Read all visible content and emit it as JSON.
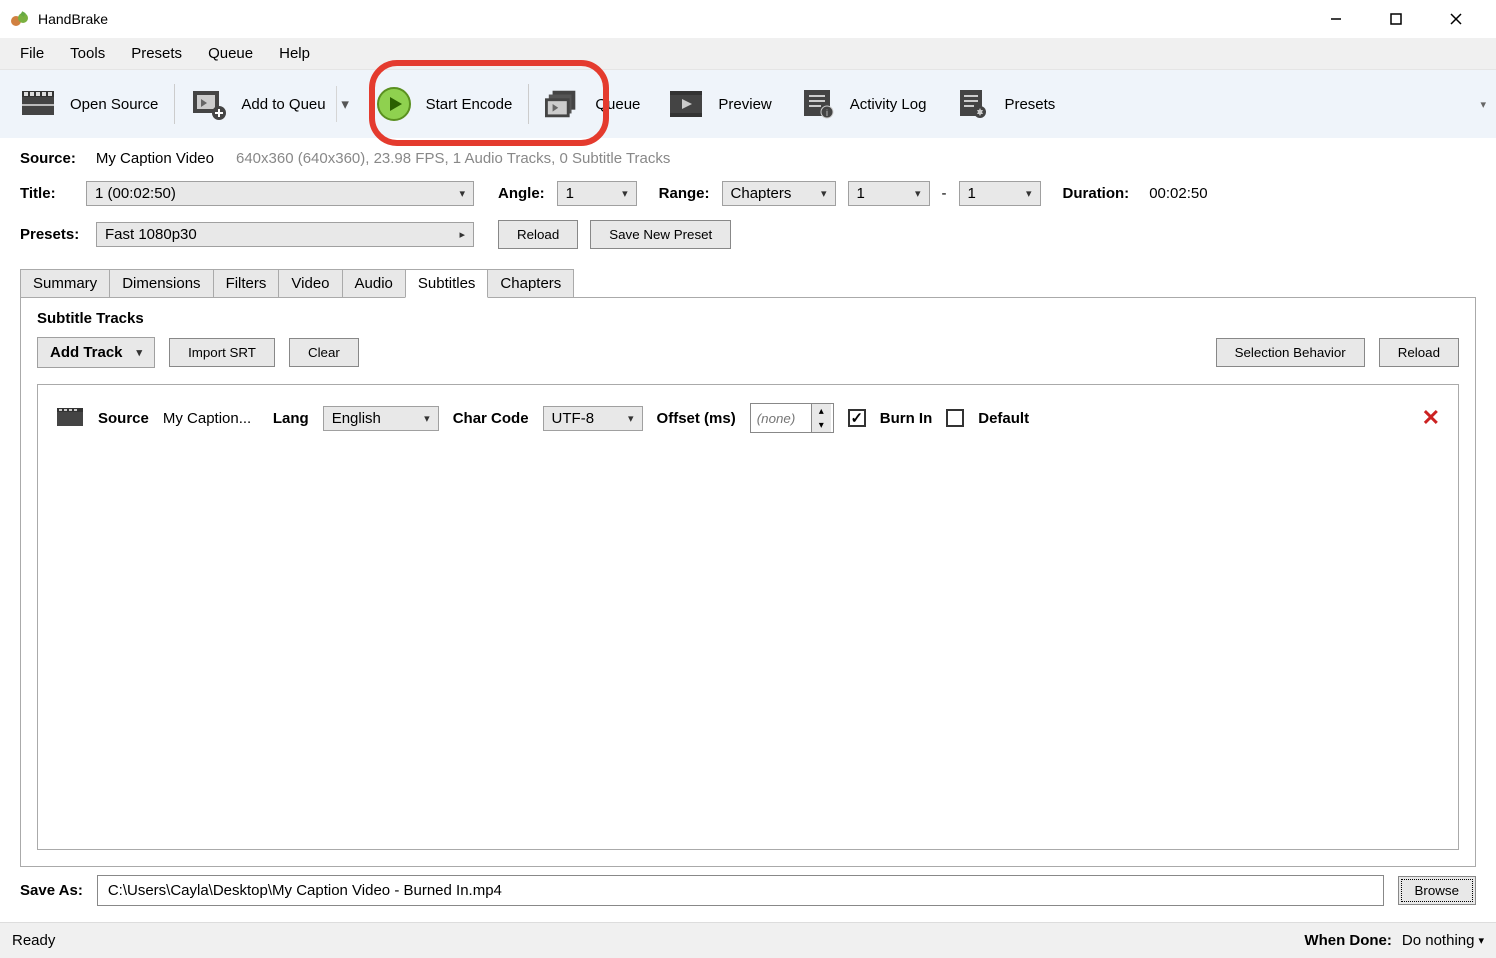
{
  "title": "HandBrake",
  "menu": [
    "File",
    "Tools",
    "Presets",
    "Queue",
    "Help"
  ],
  "toolbar": {
    "open_source": "Open Source",
    "add_queue": "Add to Queu",
    "start_encode": "Start Encode",
    "queue": "Queue",
    "preview": "Preview",
    "activity": "Activity Log",
    "presets": "Presets"
  },
  "source": {
    "label": "Source:",
    "name": "My Caption Video",
    "meta": "640x360 (640x360), 23.98 FPS, 1 Audio Tracks, 0 Subtitle Tracks"
  },
  "title_row": {
    "label": "Title:",
    "value": "1 (00:02:50)",
    "angle_label": "Angle:",
    "angle": "1",
    "range_label": "Range:",
    "range_type": "Chapters",
    "range_from": "1",
    "dash": "-",
    "range_to": "1",
    "duration_label": "Duration:",
    "duration": "00:02:50"
  },
  "presets_row": {
    "label": "Presets:",
    "value": "Fast 1080p30",
    "reload": "Reload",
    "save_new": "Save New Preset"
  },
  "tabs": [
    "Summary",
    "Dimensions",
    "Filters",
    "Video",
    "Audio",
    "Subtitles",
    "Chapters"
  ],
  "active_tab": "Subtitles",
  "subtitles": {
    "header": "Subtitle Tracks",
    "add_track": "Add Track",
    "import_srt": "Import SRT",
    "clear": "Clear",
    "selection_behavior": "Selection Behavior",
    "reload": "Reload",
    "track": {
      "source_label": "Source",
      "source_value": "My Caption...",
      "lang_label": "Lang",
      "lang_value": "English",
      "charcode_label": "Char Code",
      "charcode_value": "UTF-8",
      "offset_label": "Offset (ms)",
      "offset_placeholder": "(none)",
      "burn_in": "Burn In",
      "default": "Default"
    }
  },
  "save_as": {
    "label": "Save As:",
    "path": "C:\\Users\\Cayla\\Desktop\\My Caption Video - Burned In.mp4",
    "browse": "Browse"
  },
  "status": {
    "text": "Ready",
    "when_done_label": "When Done:",
    "when_done_value": "Do nothing"
  }
}
